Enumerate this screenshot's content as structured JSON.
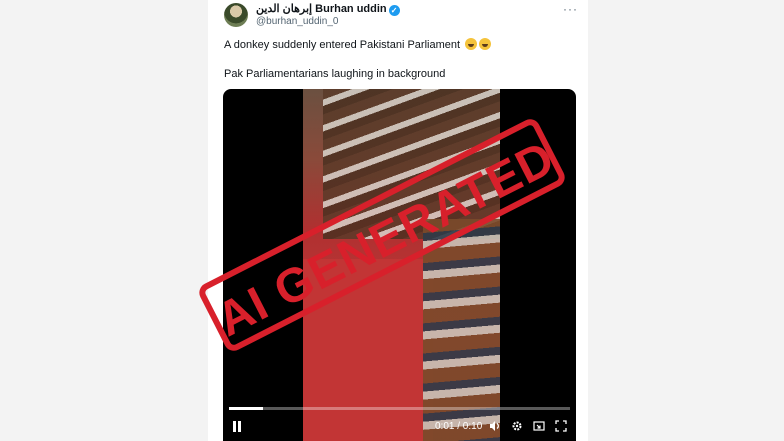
{
  "post": {
    "display_name": "إبرهان الدين Burhan uddin",
    "handle": "@burhan_uddin_0",
    "more_label": "···",
    "line1": "A donkey suddenly entered Pakistani Parliament",
    "line2": "Pak Parliamentarians laughing in background",
    "emojis": [
      "rolling-on-floor-laughing-emoji",
      "rolling-on-floor-laughing-emoji"
    ]
  },
  "video": {
    "overlay_stamp": "AI GENERATED",
    "stamp_color": "#d8202b",
    "time": "0:01 / 0:10",
    "progress": 0.1,
    "controls": [
      "pause-icon",
      "volume-icon",
      "settings-icon",
      "pip-icon",
      "fullscreen-icon"
    ]
  },
  "colors": {
    "verified": "#1d9bf0",
    "text": "#0f1419",
    "secondary": "#536471"
  }
}
